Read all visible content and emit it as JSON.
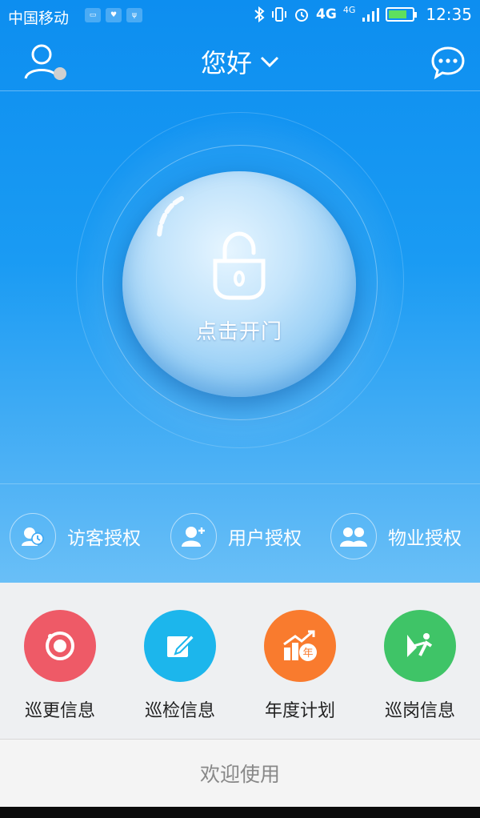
{
  "status_bar": {
    "carrier": "中国移动",
    "network_1": "4G",
    "network_2": "4G",
    "time": "12:35",
    "icons": [
      "sim-icon",
      "heart-rate-icon",
      "usb-icon",
      "bluetooth-icon",
      "vibrate-icon",
      "alarm-icon",
      "signal-icon",
      "battery-icon"
    ]
  },
  "header": {
    "greeting": "您好",
    "icons": [
      "user-icon",
      "chevron-down-icon",
      "chat-icon"
    ]
  },
  "door": {
    "label": "点击开门",
    "icon": "unlock-icon"
  },
  "auth": [
    {
      "label": "访客授权",
      "icon": "visitor-icon"
    },
    {
      "label": "用户授权",
      "icon": "add-user-icon"
    },
    {
      "label": "物业授权",
      "icon": "group-icon"
    }
  ],
  "menu": [
    {
      "label": "巡更信息",
      "icon": "patrol-icon",
      "color": "#ee5a67"
    },
    {
      "label": "巡检信息",
      "icon": "edit-icon",
      "color": "#1cb6ec"
    },
    {
      "label": "年度计划",
      "icon": "yearly-chart-icon",
      "color": "#f97b2e"
    },
    {
      "label": "巡岗信息",
      "icon": "post-icon",
      "color": "#3fc467"
    }
  ],
  "footer": {
    "welcome": "欢迎使用"
  },
  "colors": {
    "primary_blue": "#1a9bf3",
    "menu_bg": "#eef0f2"
  }
}
